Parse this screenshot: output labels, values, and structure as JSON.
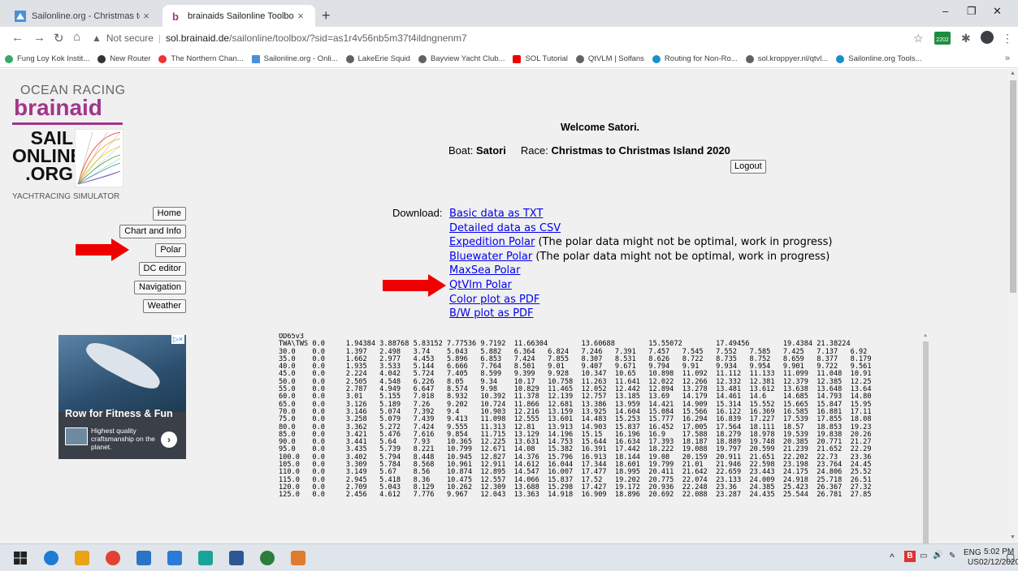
{
  "browser": {
    "tabs": [
      {
        "title": "Sailonline.org - Christmas to Chr"
      },
      {
        "title": "brainaids Sailonline Toolbox"
      }
    ],
    "address": {
      "security_label": "Not secure",
      "host": "sol.brainaid.de",
      "path": "/sailonline/toolbox/?sid=as1r4v56nb5m37t4ildngnenm7"
    },
    "extension_badge": "2202",
    "bookmarks": [
      {
        "label": "Fung Loy Kok Instit...",
        "icon_color": "#3a6"
      },
      {
        "label": "New Router",
        "icon_color": "#333"
      },
      {
        "label": "The Northern Chan...",
        "icon_color": "#e33"
      },
      {
        "label": "Sailonline.org - Onli...",
        "icon_color": "#4a90d9"
      },
      {
        "label": "LakeErie Squid",
        "icon_color": "#5f6368"
      },
      {
        "label": "Bayview Yacht Club...",
        "icon_color": "#5f6368"
      },
      {
        "label": "SOL Tutorial",
        "icon_color": "#e00"
      },
      {
        "label": "QtVLM | Solfans",
        "icon_color": "#5f6368"
      },
      {
        "label": "Routing for Non-Ro...",
        "icon_color": "#1a8fc9"
      },
      {
        "label": "sol.kroppyer.nl/qtvl...",
        "icon_color": "#5f6368"
      },
      {
        "label": "Sailonline.org Tools...",
        "icon_color": "#1a8fc9"
      }
    ],
    "bookmarks_more": "»"
  },
  "page": {
    "logo": {
      "ocean_racing": "OCEAN RACING",
      "brainaid": "brainaid",
      "sail_line1": "SAIL",
      "sail_line2": "ONLINE",
      "sail_line3": ".ORG",
      "tagline": "YACHTRACING SIMULATOR"
    },
    "welcome": "Welcome Satori.",
    "boat_label": "Boat:",
    "boat_name": "Satori",
    "race_label": "Race:",
    "race_name": "Christmas to Christmas Island 2020",
    "logout_label": "Logout",
    "nav": [
      {
        "label": "Home"
      },
      {
        "label": "Chart and Info"
      },
      {
        "label": "Polar"
      },
      {
        "label": "DC editor"
      },
      {
        "label": "Navigation"
      },
      {
        "label": "Weather"
      }
    ],
    "download_label": "Download:",
    "downloads": [
      {
        "link": "Basic data as TXT",
        "note": ""
      },
      {
        "link": "Detailed data as CSV",
        "note": ""
      },
      {
        "link": "Expedition Polar",
        "note": " (The polar data might not be optimal, work in progress)"
      },
      {
        "link": "Bluewater Polar",
        "note": " (The polar data might not be optimal, work in progress)"
      },
      {
        "link": "MaxSea Polar",
        "note": ""
      },
      {
        "link": "QtVlm Polar",
        "note": ""
      },
      {
        "link": "Color plot as PDF",
        "note": ""
      },
      {
        "link": "B/W plot as PDF",
        "note": ""
      }
    ],
    "ad": {
      "choice_label": "▷×",
      "title": "Row for Fitness & Fun",
      "text": "Highest quality craftsmanship on the planet.",
      "go_label": "›"
    },
    "polar_text": "OD65v3\nTWA\\TWS 0.0     1.94384 3.88768 5.83152 7.77536 9.7192  11.66304        13.60688        15.55072        17.49456        19.4384 21.38224\n30.0    0.0     1.397   2.498   3.74    5.043   5.882   6.364   6.824   7.246   7.391   7.457   7.545   7.552   7.585   7.425   7.137   6.92\n35.0    0.0     1.662   2.977   4.453   5.896   6.853   7.424   7.855   8.307   8.531   8.626   8.722   8.735   8.752   8.659   8.377   8.179\n40.0    0.0     1.935   3.533   5.144   6.666   7.764   8.501   9.01    9.407   9.671   9.794   9.91    9.934   9.954   9.901   9.722   9.561\n45.0    0.0     2.224   4.042   5.724   7.405   8.599   9.399   9.928   10.347  10.65   10.898  11.092  11.112  11.133  11.099  11.048  10.91\n50.0    0.0     2.505   4.548   6.226   8.05    9.34    10.17   10.758  11.263  11.641  12.022  12.266  12.332  12.381  12.379  12.385  12.25\n55.0    0.0     2.787   4.949   6.647   8.574   9.98    10.829  11.465  12.052  12.442  12.894  13.278  13.481  13.612  13.638  13.648  13.64\n60.0    0.0     3.01    5.155   7.018   8.932   10.392  11.378  12.139  12.757  13.185  13.69   14.179  14.461  14.6    14.685  14.793  14.80\n65.0    0.0     3.126   5.189   7.26    9.202   10.724  11.866  12.681  13.386  13.959  14.421  14.909  15.314  15.552  15.665  15.847  15.95\n70.0    0.0     3.146   5.074   7.392   9.4     10.903  12.216  13.159  13.925  14.604  15.084  15.566  16.122  16.369  16.585  16.881  17.11\n75.0    0.0     3.258   5.079   7.439   9.413   11.098  12.555  13.601  14.483  15.253  15.777  16.294  16.839  17.227  17.539  17.855  18.08\n80.0    0.0     3.362   5.272   7.424   9.555   11.313  12.81   13.913  14.903  15.837  16.452  17.005  17.564  18.111  18.57   18.853  19.23\n85.0    0.0     3.421   5.476   7.616   9.854   11.715  13.129  14.196  15.15   16.196  16.9    17.588  18.279  18.978  19.539  19.838  20.26\n90.0    0.0     3.441   5.64    7.93    10.365  12.225  13.631  14.753  15.644  16.634  17.393  18.187  18.889  19.748  20.385  20.771  21.27\n95.0    0.0     3.435   5.739   8.221   10.799  12.671  14.08   15.382  16.391  17.442  18.222  19.088  19.797  20.599  21.239  21.652  22.29\n100.0   0.0     3.402   5.794   8.448   10.945  12.827  14.376  15.796  16.913  18.144  19.08   20.159  20.911  21.651  22.202  22.73   23.36\n105.0   0.0     3.309   5.784   8.568   10.961  12.911  14.612  16.044  17.344  18.601  19.799  21.01   21.946  22.598  23.198  23.764  24.45\n110.0   0.0     3.149   5.67    8.56    10.874  12.895  14.547  16.007  17.477  18.995  20.411  21.642  22.659  23.443  24.175  24.806  25.52\n115.0   0.0     2.945   5.418   8.36    10.475  12.557  14.066  15.837  17.52   19.202  20.775  22.074  23.133  24.009  24.918  25.718  26.51\n120.0   0.0     2.709   5.043   8.129   10.262  12.309  13.688  15.298  17.427  19.172  20.936  22.248  23.36   24.385  25.423  26.367  27.32\n125.0   0.0     2.456   4.612   7.776   9.967   12.043  13.363  14.918  16.909  18.896  20.692  22.088  23.287  24.435  25.544  26.781  27.85",
    "colors": {
      "link": "#0000ee",
      "arrow": "#ee0000",
      "brand": "#a0368a"
    }
  },
  "taskbar": {
    "lang": "ENG",
    "region": "US",
    "time": "5:02 PM",
    "date": "02/12/2020"
  }
}
